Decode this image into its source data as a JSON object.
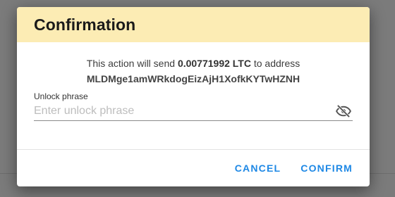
{
  "dialog": {
    "title": "Confirmation",
    "message": {
      "prefix": "This action will send",
      "amount": "0.00771992 LTC",
      "suffix": "to address",
      "address": "MLDMge1amWRkdogEizAjH1XofkKYTwHZNH"
    },
    "unlock_field": {
      "label": "Unlock phrase",
      "placeholder": "Enter unlock phrase",
      "value": "",
      "toggle_icon": "eye-off-icon"
    },
    "actions": {
      "cancel_label": "CANCEL",
      "confirm_label": "CONFIRM"
    }
  },
  "colors": {
    "header_bg": "#fcecb4",
    "accent": "#1e88e5",
    "backdrop": "#7b7b7b"
  }
}
